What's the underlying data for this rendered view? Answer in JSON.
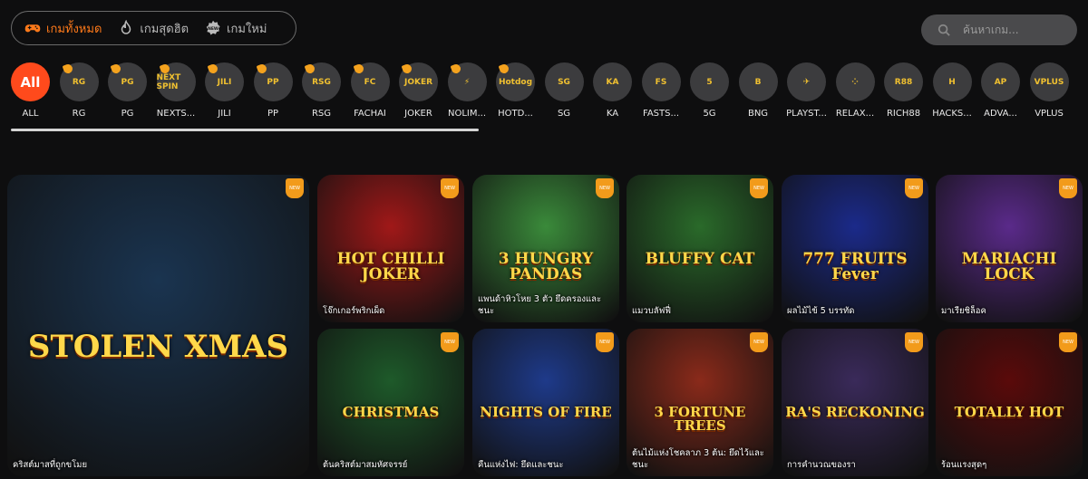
{
  "tabs": [
    {
      "label": "เกมทั้งหมด",
      "icon": "gamepad-icon",
      "active": true
    },
    {
      "label": "เกมสุดฮิต",
      "icon": "fire-icon",
      "active": false
    },
    {
      "label": "เกมใหม่",
      "icon": "new-badge-icon",
      "active": false
    }
  ],
  "search": {
    "placeholder": "ค้นหาเกม..."
  },
  "providers": [
    {
      "label": "ALL",
      "logo": "All"
    },
    {
      "label": "RG",
      "logo": "RG"
    },
    {
      "label": "PG",
      "logo": "PG"
    },
    {
      "label": "NEXTS...",
      "logo": "NEXT SPIN"
    },
    {
      "label": "JILI",
      "logo": "JILI"
    },
    {
      "label": "PP",
      "logo": "PP"
    },
    {
      "label": "RSG",
      "logo": "RSG"
    },
    {
      "label": "FACHAI",
      "logo": "FC"
    },
    {
      "label": "JOKER",
      "logo": "JOKER"
    },
    {
      "label": "NOLIM...",
      "logo": "⚡"
    },
    {
      "label": "HOTD...",
      "logo": "Hotdog"
    },
    {
      "label": "SG",
      "logo": "SG"
    },
    {
      "label": "KA",
      "logo": "KA"
    },
    {
      "label": "FASTS...",
      "logo": "FS"
    },
    {
      "label": "5G",
      "logo": "5"
    },
    {
      "label": "BNG",
      "logo": "B"
    },
    {
      "label": "PLAYST...",
      "logo": "✈"
    },
    {
      "label": "RELAX...",
      "logo": "⁘"
    },
    {
      "label": "RICH88",
      "logo": "R88"
    },
    {
      "label": "HACKS...",
      "logo": "H"
    },
    {
      "label": "ADVA...",
      "logo": "AP"
    },
    {
      "label": "VPLUS",
      "logo": "VPLUS"
    }
  ],
  "games": [
    {
      "name": "คริสต์มาสที่ถูกขโมย",
      "title": "STOLEN XMAS",
      "bg": "#1a3450"
    },
    {
      "name": "โจ๊กเกอร์พริกเผ็ด",
      "title": "HOT CHILLI JOKER",
      "bg": "#a01818"
    },
    {
      "name": "แพนด้าหิวโหย 3 ตัว ยึดครองและชนะ",
      "title": "3 HUNGRY PANDAS",
      "bg": "#3a8a3a"
    },
    {
      "name": "แมวบลัฟฟี่",
      "title": "BLUFFY CAT",
      "bg": "#2a6a2a"
    },
    {
      "name": "ผลไม้ไข้ 5 บรรทัด",
      "title": "777 FRUITS Fever",
      "bg": "#1b2a8a"
    },
    {
      "name": "มาเรียชิล็อค",
      "title": "MARIACHI LOCK",
      "bg": "#5a2a8a"
    },
    {
      "name": "ต้นคริสต์มาสมหัศจรรย์",
      "title": "CHRISTMAS",
      "bg": "#1e5a2a"
    },
    {
      "name": "คืนแห่งไฟ: ยึดและชนะ",
      "title": "NIGHTS OF FIRE",
      "bg": "#1e3a8a"
    },
    {
      "name": "ต้นไม้แห่งโชคลาภ 3 ต้น: ยึดไว้และชนะ",
      "title": "3 FORTUNE TREES",
      "bg": "#8a2a1a"
    },
    {
      "name": "การคำนวณของรา",
      "title": "RA'S RECKONING",
      "bg": "#3a2a5a"
    },
    {
      "name": "ร้อนแรงสุดๆ",
      "title": "TOTALLY HOT",
      "bg": "#5a0a0a"
    }
  ],
  "new_tag": "NEW",
  "colors": {
    "accent": "#ff7a1a",
    "active_provider": "#ff4a1c",
    "provider_bg": "#3c3c3e",
    "new_badge": "#f29b1b"
  }
}
